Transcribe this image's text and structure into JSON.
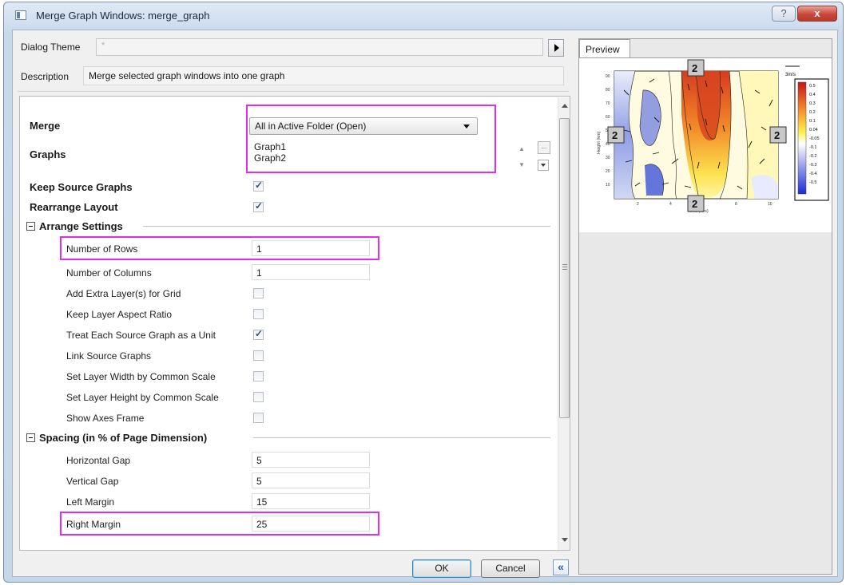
{
  "window": {
    "title": "Merge Graph Windows: merge_graph",
    "help_label": "?",
    "close_label": "x"
  },
  "theme": {
    "label": "Dialog Theme",
    "value": "*"
  },
  "description": {
    "label": "Description",
    "text": "Merge selected graph windows into one graph"
  },
  "merge": {
    "label": "Merge",
    "value": "All in Active Folder (Open)"
  },
  "graphs": {
    "label": "Graphs",
    "items": [
      "Graph1",
      "Graph2"
    ],
    "browse_label": "..."
  },
  "keep_source": {
    "label": "Keep Source Graphs",
    "checked": true
  },
  "rearrange": {
    "label": "Rearrange Layout",
    "checked": true
  },
  "arrange": {
    "title": "Arrange Settings",
    "rows": [
      {
        "label": "Number of Rows",
        "value": "1"
      },
      {
        "label": "Number of Columns",
        "value": "1"
      }
    ],
    "checks": [
      {
        "label": "Add Extra Layer(s) for Grid",
        "checked": false
      },
      {
        "label": "Keep Layer Aspect Ratio",
        "checked": false
      },
      {
        "label": "Treat Each Source Graph as a Unit",
        "checked": true
      },
      {
        "label": "Link Source Graphs",
        "checked": false
      },
      {
        "label": "Set Layer Width by Common Scale",
        "checked": false
      },
      {
        "label": "Set Layer Height by Common Scale",
        "checked": false
      },
      {
        "label": "Show Axes Frame",
        "checked": false
      }
    ]
  },
  "spacing": {
    "title": "Spacing (in % of Page Dimension)",
    "fields": [
      {
        "label": "Horizontal Gap",
        "value": "5"
      },
      {
        "label": "Vertical Gap",
        "value": "5"
      },
      {
        "label": "Left Margin",
        "value": "15"
      },
      {
        "label": "Right Margin",
        "value": "25"
      }
    ]
  },
  "buttons": {
    "ok": "OK",
    "cancel": "Cancel",
    "collapse": "«"
  },
  "preview": {
    "tab_label": "Preview",
    "badge": "2",
    "xlabel": "Time (Hrs)",
    "ylabel": "Height (km)",
    "legend_title": "3m/s",
    "colorbar_labels": [
      "0.5",
      "0.4",
      "0.3",
      "0.2",
      "0.1",
      "0.04",
      "-0.05",
      "-0.1",
      "-0.2",
      "-0.3",
      "-0.4",
      "-0.5"
    ],
    "xticks": [
      "2",
      "4",
      "6",
      "8",
      "10"
    ],
    "yticks": [
      "90",
      "80",
      "70",
      "60",
      "50",
      "40",
      "30",
      "20",
      "10"
    ],
    "colors": {
      "warm": "#e8502a",
      "mid": "#fff04a",
      "cool": "#3a52d6"
    }
  }
}
